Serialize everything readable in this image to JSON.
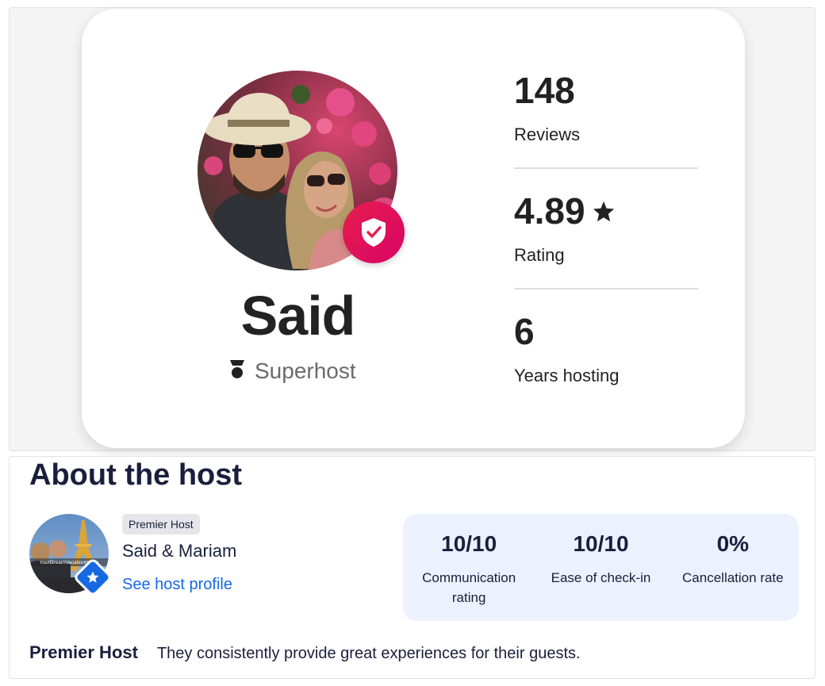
{
  "host_card": {
    "name": "Said",
    "badge_label": "Superhost",
    "stats": [
      {
        "value": "148",
        "label": "Reviews"
      },
      {
        "value": "4.89",
        "label": "Rating",
        "icon": "star-icon"
      },
      {
        "value": "6",
        "label": "Years hosting"
      }
    ],
    "verified_icon": "shield-check-icon",
    "badge_icon": "superhost-medal-icon",
    "accent_color": "#e61e4d"
  },
  "about": {
    "title": "About the host",
    "avatar_caption": "YourDreamVacationHome",
    "pill": "Premier Host",
    "host_names": "Said & Mariam",
    "profile_link": "See host profile",
    "metrics": [
      {
        "value": "10/10",
        "label": "Communication rating"
      },
      {
        "value": "10/10",
        "label": "Ease of check-in"
      },
      {
        "value": "0%",
        "label": "Cancellation rate"
      }
    ],
    "premier_title": "Premier Host",
    "premier_desc": "They consistently provide great experiences for their guests.",
    "link_color": "#1668e3",
    "badge_icon": "star-icon"
  }
}
